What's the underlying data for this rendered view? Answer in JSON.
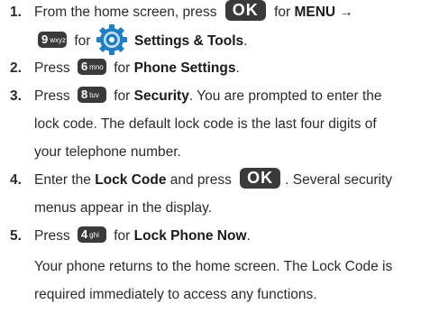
{
  "steps": [
    {
      "number": "1.",
      "t1": "From the home screen, press",
      "k1": "OK",
      "t2": "for",
      "b1": "MENU",
      "arrow": "→",
      "k2_big": "9",
      "k2_sub": "wxyz",
      "t3": "for",
      "b2": "Settings & Tools",
      "t4": "."
    },
    {
      "number": "2.",
      "t1": "Press",
      "k1_big": "6",
      "k1_sub": "mno",
      "t2": "for",
      "b1": "Phone Settings",
      "t3": "."
    },
    {
      "number": "3.",
      "t1": "Press",
      "k1_big": "8",
      "k1_sub": "tuv",
      "t2": "for",
      "b1": "Security",
      "t3": ". You are prompted to enter the",
      "line2": "lock code. The default lock code is the last four digits of",
      "line3": "your telephone number."
    },
    {
      "number": "4.",
      "t1": "Enter the",
      "b1": "Lock Code",
      "t2": "and press",
      "k1": "OK",
      "t3": ". Several security",
      "line2": "menus appear in the display."
    },
    {
      "number": "5.",
      "t1": "Press",
      "k1_big": "4",
      "k1_sub": "ghi",
      "t2": "for",
      "b1": "Lock Phone Now",
      "t3": "."
    }
  ],
  "note": {
    "line1": "Your phone returns to the home screen. The Lock Code is",
    "line2": "required immediately to access any functions."
  },
  "colors": {
    "text": "#2b2b2b",
    "key": "#3a3a3a",
    "gear_blue": "#1f7fc4"
  }
}
